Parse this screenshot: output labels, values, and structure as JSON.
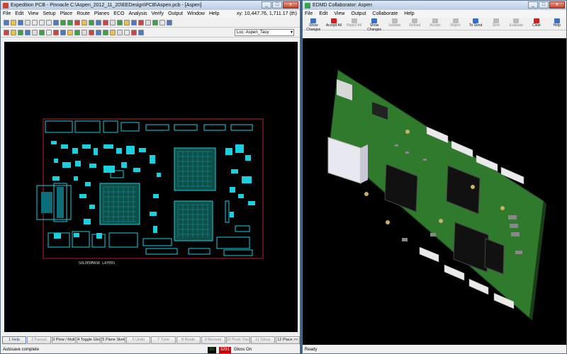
{
  "left": {
    "title": "Expedition PCB - Pinnacle  C:\\Aspen_2012_11_20\\EEDesign\\PCB\\Aspen.pcb - [Aspen]",
    "menu": [
      "File",
      "Edit",
      "View",
      "Setup",
      "Place",
      "Route",
      "Planes",
      "ECO",
      "Analysis",
      "Verify",
      "Output",
      "Window",
      "Help"
    ],
    "coord": "xy: 10,447.76, 1,711.17  (th)",
    "location": "Loc: Aspen_Tasy",
    "board_label": "SOLDERMASK LAYERS",
    "fkeys": [
      {
        "label": "1 Help",
        "state": "sel"
      },
      {
        "label": "2 Fanout",
        "state": "off"
      },
      {
        "label": "3 Plow / Multi",
        "state": "on"
      },
      {
        "label": "4 Toggle Gloss",
        "state": "on"
      },
      {
        "label": "5 Plane Sketch",
        "state": "on"
      },
      {
        "label": "6 Undo",
        "state": "off"
      },
      {
        "label": "7 Tune",
        "state": "off"
      },
      {
        "label": "8 Route",
        "state": "off"
      },
      {
        "label": "9 Reroute",
        "state": "off"
      },
      {
        "label": "10 Push Trace",
        "state": "off"
      },
      {
        "label": "11 Gloss",
        "state": "off"
      },
      {
        "label": "12 Place >>",
        "state": "on"
      }
    ],
    "status": "Autosave complete",
    "status_badge1": "3V",
    "status_badge2": "3291",
    "status_gloss": "Gloss On"
  },
  "right": {
    "title": "EDMD Collaborator: Aspen",
    "menu": [
      "File",
      "Edit",
      "View",
      "Output",
      "Collaborate",
      "Help"
    ],
    "tools": [
      {
        "label": "Show Changes",
        "state": "on"
      },
      {
        "label": "Accept All",
        "state": "on red"
      },
      {
        "label": "Reject All",
        "state": "off"
      },
      {
        "label": "Show Changes",
        "state": "on"
      },
      {
        "label": "Validate",
        "state": "off"
      },
      {
        "label": "Reload",
        "state": "off"
      },
      {
        "label": "Accept",
        "state": "off"
      },
      {
        "label": "Reject",
        "state": "off"
      },
      {
        "label": "To Send",
        "state": "on"
      },
      {
        "label": "Sent",
        "state": "off"
      },
      {
        "label": "Evaluate",
        "state": "off"
      },
      {
        "label": "Clear",
        "state": "on red"
      },
      {
        "label": "Help",
        "state": "on"
      }
    ],
    "status": "Ready"
  },
  "colors": {
    "pcb_outline": "#c0202a",
    "pcb_cyan": "#18d0e0",
    "pcb_green": "#2f8f2f",
    "canvas": "#000000"
  }
}
